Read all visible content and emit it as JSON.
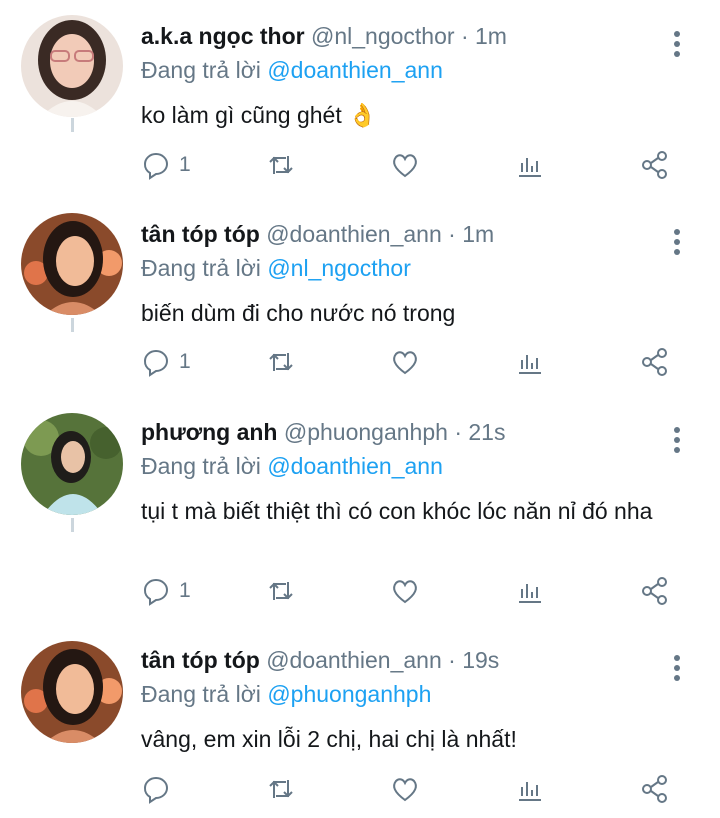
{
  "tweets": [
    {
      "name": "a.k.a ngọc thor",
      "handle": "@nl_ngocthor",
      "time": "1m",
      "reply_prefix": "Đang trả lời",
      "reply_to": "@doanthien_ann",
      "text": "ko làm gì cũng ghét 👌",
      "reply_count": "1",
      "avatar_colors": [
        "#e9d8cf",
        "#3a2a24",
        "#f2c9b6"
      ]
    },
    {
      "name": "tân tóp tóp",
      "handle": "@doanthien_ann",
      "time": "1m",
      "reply_prefix": "Đang trả lời",
      "reply_to": "@nl_ngocthor",
      "text": "biến dùm đi cho nước nó trong",
      "reply_count": "1",
      "avatar_colors": [
        "#7a3d22",
        "#2a1a14",
        "#f0b48f"
      ]
    },
    {
      "name": "phương anh",
      "handle": "@phuonganhph",
      "time": "21s",
      "reply_prefix": "Đang trả lời",
      "reply_to": "@doanthien_ann",
      "text": "tụi t mà biết thiệt thì có con khóc lóc năn nỉ đó nha",
      "reply_count": "1",
      "avatar_colors": [
        "#5f7a3a",
        "#1f1d1a",
        "#bfe3ea"
      ]
    },
    {
      "name": "tân tóp tóp",
      "handle": "@doanthien_ann",
      "time": "19s",
      "reply_prefix": "Đang trả lời",
      "reply_to": "@phuonganhph",
      "text": "vâng, em xin lỗi 2 chị, hai chị là nhất!",
      "reply_count": "",
      "avatar_colors": [
        "#7a3d22",
        "#2a1a14",
        "#f0b48f"
      ]
    }
  ],
  "separator": "·",
  "colors": {
    "name": "#14171a",
    "meta": "#657786",
    "mention": "#1da1f2",
    "thread_line": "#ccd6dd"
  }
}
